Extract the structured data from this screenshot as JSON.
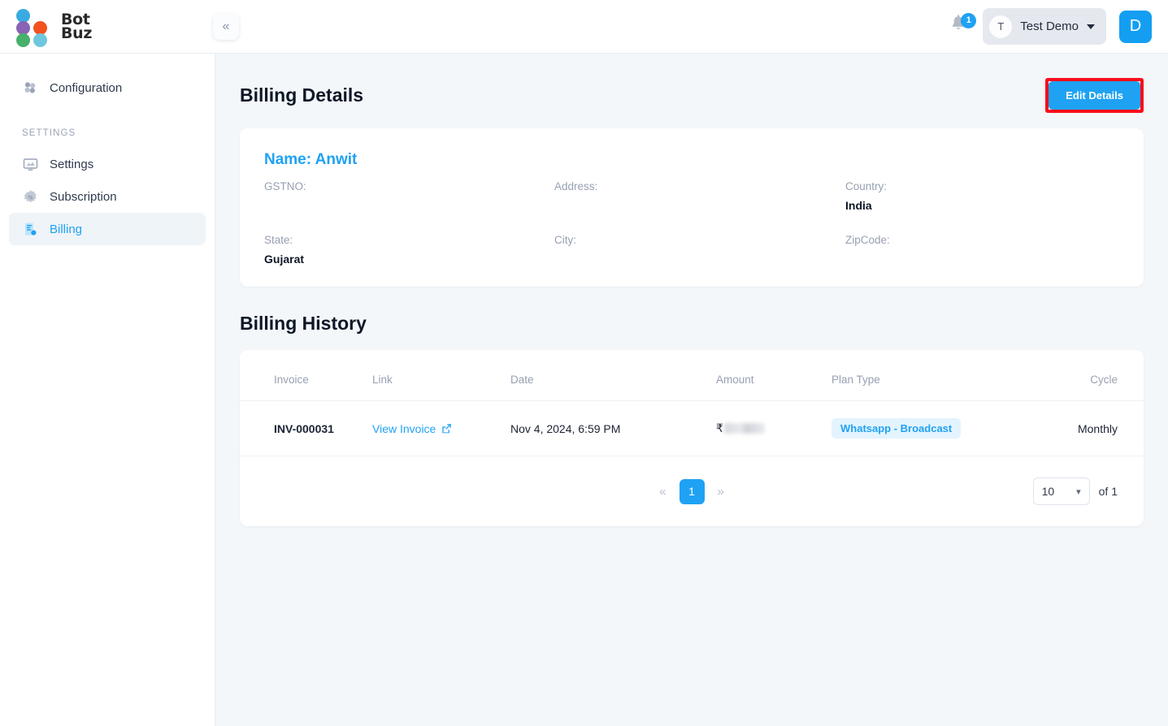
{
  "brand": {
    "name_line1": "Bot",
    "name_line2": "Buz",
    "dot_colors": [
      "#3aabe0",
      "#8a63b5",
      "#f3521f",
      "#47b06b",
      "#6fc7dd"
    ]
  },
  "topbar": {
    "collapse_icon": "chevron-double-left-icon",
    "notification_icon": "bell-icon",
    "notification_count": "1",
    "account_initial": "T",
    "account_name": "Test Demo",
    "user_initial": "D"
  },
  "sidebar": {
    "top_items": [
      {
        "label": "Configuration",
        "icon": "puzzle-icon",
        "active": false
      }
    ],
    "section_label": "SETTINGS",
    "items": [
      {
        "label": "Settings",
        "icon": "monitor-icon",
        "active": false
      },
      {
        "label": "Subscription",
        "icon": "percent-badge-icon",
        "active": false
      },
      {
        "label": "Billing",
        "icon": "invoice-icon",
        "active": true
      }
    ]
  },
  "billing_details": {
    "title": "Billing Details",
    "edit_button": "Edit Details",
    "name_line": "Name: Anwit",
    "fields": [
      {
        "label": "GSTNO:",
        "value": ""
      },
      {
        "label": "Address:",
        "value": ""
      },
      {
        "label": "Country:",
        "value": "India"
      },
      {
        "label": "State:",
        "value": "Gujarat"
      },
      {
        "label": "City:",
        "value": ""
      },
      {
        "label": "ZipCode:",
        "value": ""
      }
    ]
  },
  "billing_history": {
    "title": "Billing History",
    "columns": [
      "Invoice",
      "Link",
      "Date",
      "Amount",
      "Plan Type",
      "Cycle"
    ],
    "rows": [
      {
        "invoice": "INV-000031",
        "link_label": "View Invoice",
        "link_icon": "external-link-icon",
        "date": "Nov 4, 2024, 6:59 PM",
        "amount_currency": "₹",
        "amount_value": "",
        "plan_type": "Whatsapp - Broadcast",
        "cycle": "Monthly"
      }
    ],
    "pagination": {
      "prev_icon": "«",
      "next_icon": "»",
      "current_page": "1",
      "page_size": "10",
      "total_label": "of 1"
    }
  },
  "colors": {
    "accent": "#1fa2f3",
    "highlight": "#fc0d1b",
    "badge_bg": "#e4f4fe",
    "canvas": "#f4f7fa"
  }
}
